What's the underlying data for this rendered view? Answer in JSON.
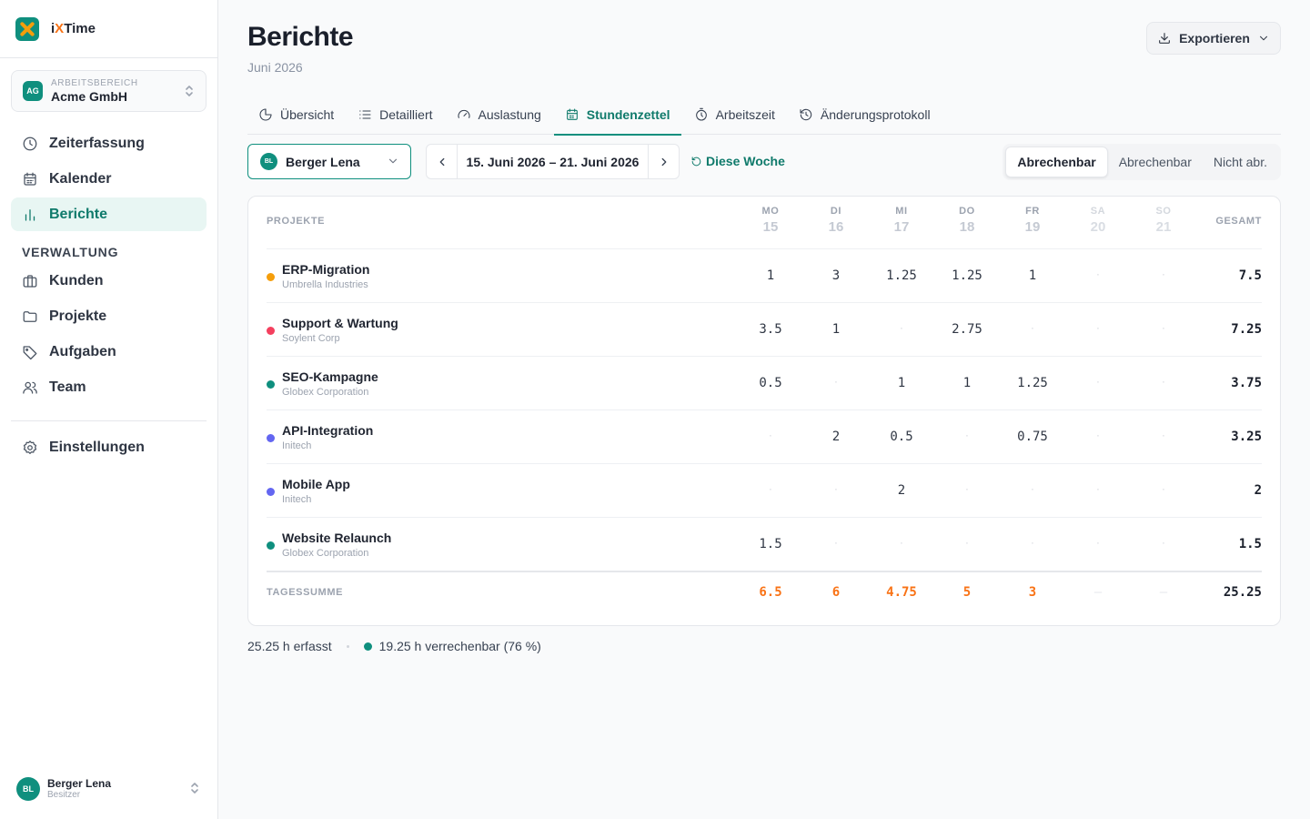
{
  "app": {
    "name_prefix": "i",
    "name_x": "X",
    "name_suffix": "Time"
  },
  "workspace": {
    "caption": "ARBEITSBEREICH",
    "name": "Acme GmbH",
    "initials": "AG"
  },
  "sidebar": {
    "main_items": [
      {
        "label": "Zeiterfassung",
        "icon": "clock-icon"
      },
      {
        "label": "Kalender",
        "icon": "calendar-icon"
      },
      {
        "label": "Berichte",
        "icon": "bar-chart-icon"
      }
    ],
    "section_title": "VERWALTUNG",
    "admin_items": [
      {
        "label": "Kunden",
        "icon": "briefcase-icon"
      },
      {
        "label": "Projekte",
        "icon": "folder-icon"
      },
      {
        "label": "Aufgaben",
        "icon": "tag-icon"
      },
      {
        "label": "Team",
        "icon": "users-icon"
      }
    ],
    "settings_label": "Einstellungen"
  },
  "user": {
    "name": "Berger Lena",
    "role": "Besitzer",
    "initials": "BL"
  },
  "header": {
    "title": "Berichte",
    "subtitle": "Juni 2026",
    "export_label": "Exportieren"
  },
  "tabs": [
    {
      "label": "Übersicht",
      "icon": "pie-icon"
    },
    {
      "label": "Detailliert",
      "icon": "list-icon"
    },
    {
      "label": "Auslastung",
      "icon": "gauge-icon"
    },
    {
      "label": "Stundenzettel",
      "icon": "calendar-icon"
    },
    {
      "label": "Arbeitszeit",
      "icon": "stopwatch-icon"
    },
    {
      "label": "Änderungsprotokoll",
      "icon": "history-icon"
    }
  ],
  "toolbar": {
    "selected_user": "Berger Lena",
    "selected_user_initials": "BL",
    "date_range": "15. Juni 2026 – 21. Juni 2026",
    "this_week_label": "Diese Woche",
    "billing_filters": [
      "Abrechenbar",
      "Abrechenbar",
      "Nicht abr."
    ]
  },
  "table": {
    "projects_header": "PROJEKTE",
    "total_header": "GESAMT",
    "days": [
      {
        "abbr": "MO",
        "date": "15"
      },
      {
        "abbr": "DI",
        "date": "16"
      },
      {
        "abbr": "MI",
        "date": "17"
      },
      {
        "abbr": "DO",
        "date": "18"
      },
      {
        "abbr": "FR",
        "date": "19"
      },
      {
        "abbr": "SA",
        "date": "20"
      },
      {
        "abbr": "SO",
        "date": "21"
      }
    ],
    "empty_marker": "·",
    "rows": [
      {
        "project": "ERP-Migration",
        "client": "Umbrella Industries",
        "color": "#f59e0b",
        "hours": [
          "1",
          "3",
          "1.25",
          "1.25",
          "1",
          "",
          ""
        ],
        "total": "7.5"
      },
      {
        "project": "Support & Wartung",
        "client": "Soylent Corp",
        "color": "#f43f5e",
        "hours": [
          "3.5",
          "1",
          "",
          "2.75",
          "",
          "",
          ""
        ],
        "total": "7.25"
      },
      {
        "project": "SEO-Kampagne",
        "client": "Globex Corporation",
        "color": "#0f8f7e",
        "hours": [
          "0.5",
          "",
          "1",
          "1",
          "1.25",
          "",
          ""
        ],
        "total": "3.75"
      },
      {
        "project": "API-Integration",
        "client": "Initech",
        "color": "#6366f1",
        "hours": [
          "",
          "2",
          "0.5",
          "",
          "0.75",
          "",
          ""
        ],
        "total": "3.25"
      },
      {
        "project": "Mobile App",
        "client": "Initech",
        "color": "#6366f1",
        "hours": [
          "",
          "",
          "2",
          "",
          "",
          "",
          ""
        ],
        "total": "2"
      },
      {
        "project": "Website Relaunch",
        "client": "Globex Corporation",
        "color": "#0f8f7e",
        "hours": [
          "1.5",
          "",
          "",
          "",
          "",
          "",
          ""
        ],
        "total": "1.5"
      }
    ],
    "daily_total_label": "TAGESSUMME",
    "daily_totals": [
      "6.5",
      "6",
      "4.75",
      "5",
      "3",
      "–",
      "–"
    ],
    "grand_total": "25.25"
  },
  "summary": {
    "recorded": "25.25 h erfasst",
    "billable": "19.25 h verrechenbar (76 %)"
  },
  "colors": {
    "accent": "#0f8f7e",
    "daily_total": "#f97316"
  }
}
